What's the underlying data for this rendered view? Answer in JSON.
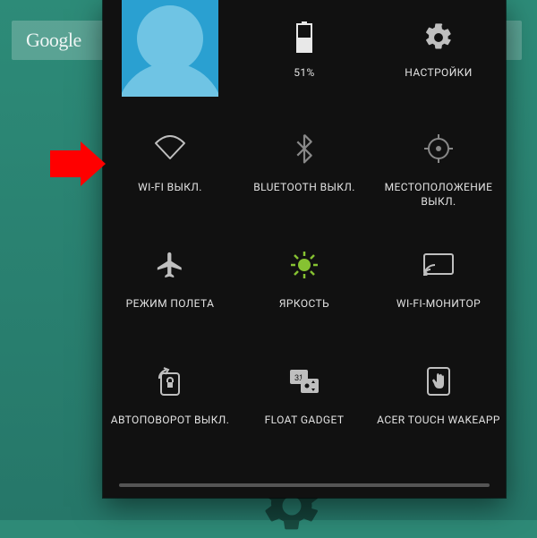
{
  "search": {
    "label": "Google"
  },
  "battery_percent": "51%",
  "tiles": {
    "battery": {
      "label": "51%"
    },
    "settings": {
      "label": "НАСТРОЙКИ"
    },
    "wifi": {
      "label": "WI-FI ВЫКЛ."
    },
    "bluetooth": {
      "label": "BLUETOOTH ВЫКЛ."
    },
    "location": {
      "label": "МЕСТОПОЛОЖЕНИЕ ВЫКЛ."
    },
    "airplane": {
      "label": "РЕЖИМ ПОЛЕТА"
    },
    "brightness": {
      "label": "ЯРКОСТЬ"
    },
    "wifi_monitor": {
      "label": "WI-FI-МОНИТОР"
    },
    "rotation": {
      "label": "АВТОПОВОРОТ ВЫКЛ."
    },
    "float_gadget": {
      "label": "FLOAT GADGET"
    },
    "wakeapp": {
      "label": "ACER TOUCH WAKEAPP"
    }
  },
  "colors": {
    "accent_green": "#86c232",
    "panel_bg": "#111111",
    "bg_teal": "#2e8a77",
    "arrow_red": "#ff0000"
  }
}
